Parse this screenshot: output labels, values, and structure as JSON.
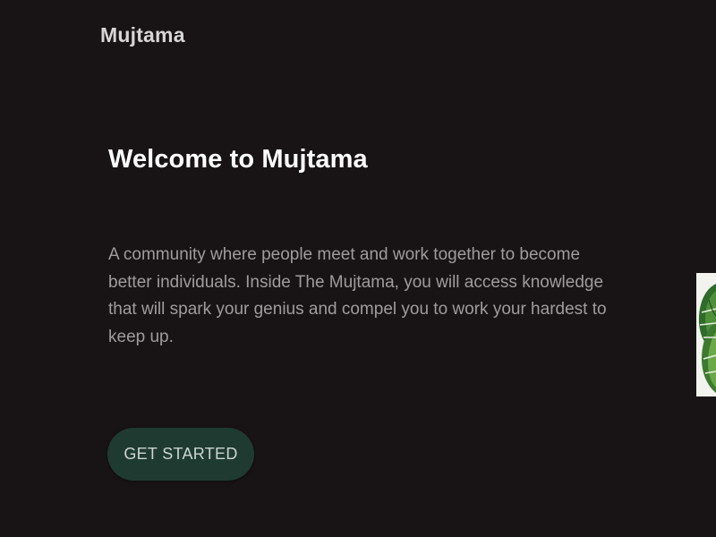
{
  "header": {
    "brand": "Mujtama"
  },
  "hero": {
    "title": "Welcome to Mujtama",
    "description": "A community where people meet and work together to become better individuals. Inside The Mujtama, you will access knowledge that will spark your genius and compel you to work your hardest to keep up.",
    "cta_label": "GET STARTED"
  },
  "image": {
    "icon": "monstera-leaf-image"
  },
  "colors": {
    "background": "#181315",
    "title": "#ffffff",
    "body_text": "#a09b9d",
    "button_bg": "#1f3a31",
    "button_text": "#c9d6cf"
  }
}
